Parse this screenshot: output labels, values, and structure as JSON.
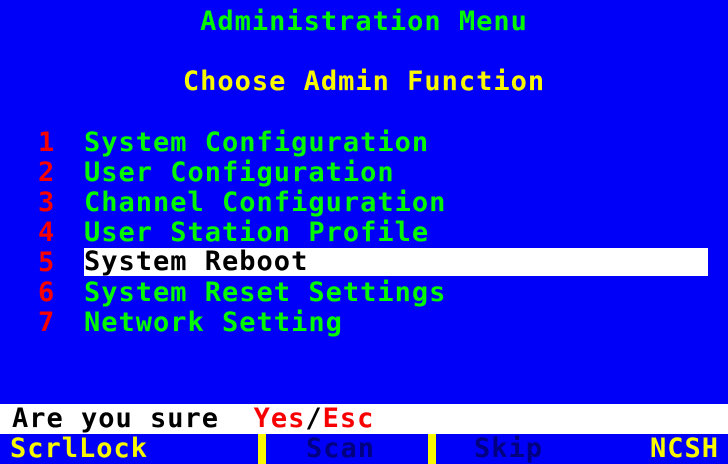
{
  "title": "Administration Menu",
  "subtitle": "Choose Admin Function",
  "menu": {
    "items": [
      {
        "num": "1",
        "label": "System Configuration"
      },
      {
        "num": "2",
        "label": "User Configuration"
      },
      {
        "num": "3",
        "label": "Channel Configuration"
      },
      {
        "num": "4",
        "label": "User Station Profile"
      },
      {
        "num": "5",
        "label": "System Reboot"
      },
      {
        "num": "6",
        "label": "System Reset Settings"
      },
      {
        "num": "7",
        "label": "Network Setting"
      }
    ],
    "selected_index": 4
  },
  "prompt": {
    "question": "Are you sure",
    "yes": "Yes",
    "separator": "/",
    "esc": "Esc"
  },
  "statusbar": {
    "scrllock": "ScrlLock",
    "scan": "Scan",
    "skip": "Skip",
    "ncsh": "NCSH"
  },
  "colors": {
    "background": "#0000F8",
    "menu_text": "#00F800",
    "number_text": "#F80000",
    "subtitle_text": "#F8F800",
    "highlight": "#FFFFFF"
  }
}
